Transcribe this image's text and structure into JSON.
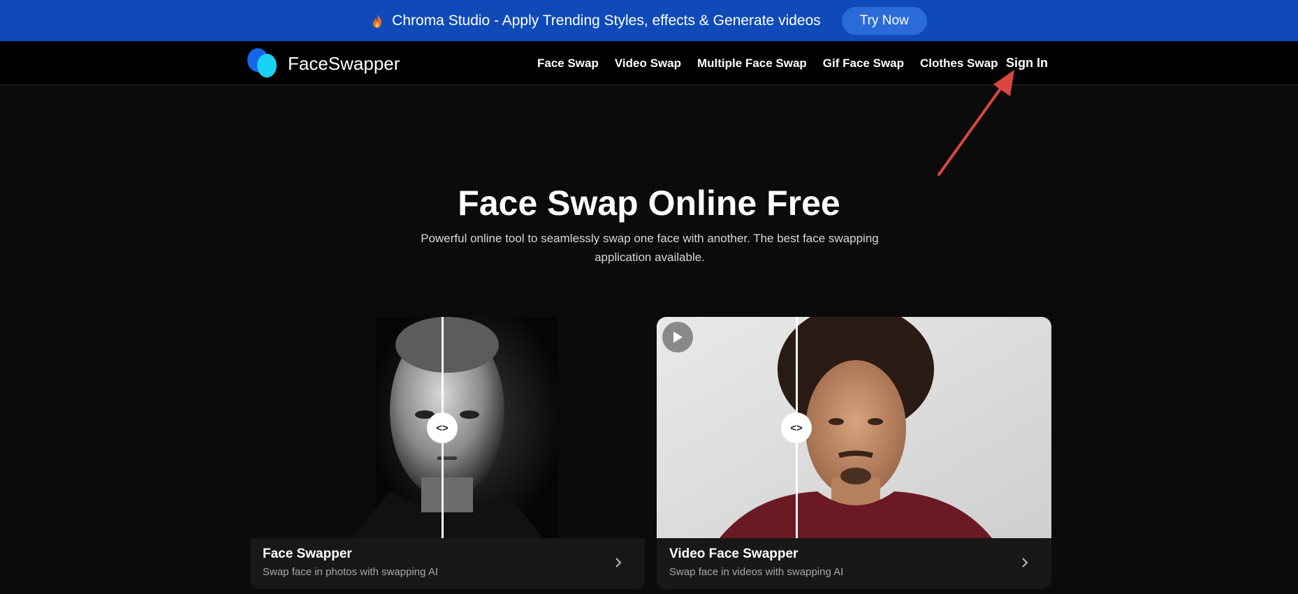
{
  "promo": {
    "text": "Chroma Studio - Apply Trending Styles, effects & Generate videos",
    "button": "Try Now",
    "icon": "flame-icon"
  },
  "header": {
    "logo": "FaceSwapper",
    "nav": [
      "Face Swap",
      "Video Swap",
      "Multiple Face Swap",
      "Gif Face Swap",
      "Clothes Swap"
    ],
    "sign_in": "Sign In"
  },
  "hero": {
    "title": "Face Swap Online Free",
    "subtitle": "Powerful online tool to seamlessly swap one face with another. The best face swapping application available."
  },
  "cards": [
    {
      "title": "Face Swapper",
      "description": "Swap face in photos with swapping AI",
      "handle": "<>"
    },
    {
      "title": "Video Face Swapper",
      "description": "Swap face in videos with swapping AI",
      "handle": "<>"
    }
  ],
  "colors": {
    "banner": "#0f4ab8",
    "annotation_arrow": "#d9473f",
    "background": "#0b0b0b"
  }
}
